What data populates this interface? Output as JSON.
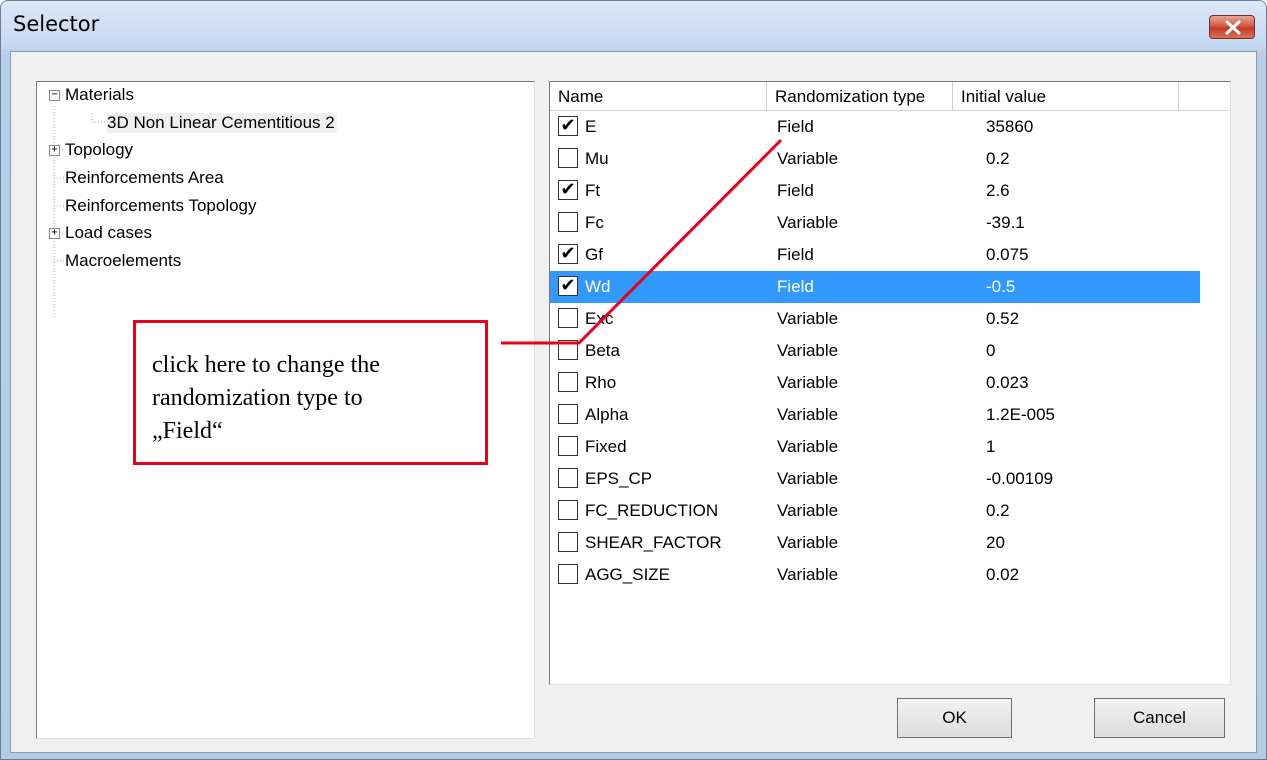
{
  "window": {
    "title": "Selector",
    "close_label": "close"
  },
  "tree": {
    "items": [
      {
        "label": "Materials",
        "expander": "minus"
      },
      {
        "label": "3D Non Linear Cementitious 2",
        "expander": ""
      },
      {
        "label": "Topology",
        "expander": "plus"
      },
      {
        "label": "Reinforcements Area",
        "expander": ""
      },
      {
        "label": "Reinforcements Topology",
        "expander": ""
      },
      {
        "label": "Load cases",
        "expander": "plus"
      },
      {
        "label": "Macroelements",
        "expander": ""
      }
    ]
  },
  "table": {
    "columns": [
      "Name",
      "Randomization type",
      "Initial value"
    ],
    "rows": [
      {
        "checked": true,
        "name": "E",
        "type": "Field",
        "value": "35860"
      },
      {
        "checked": false,
        "name": "Mu",
        "type": "Variable",
        "value": "0.2"
      },
      {
        "checked": true,
        "name": "Ft",
        "type": "Field",
        "value": "2.6"
      },
      {
        "checked": false,
        "name": "Fc",
        "type": "Variable",
        "value": "-39.1"
      },
      {
        "checked": true,
        "name": "Gf",
        "type": "Field",
        "value": "0.075"
      },
      {
        "checked": true,
        "name": "Wd",
        "type": "Field",
        "value": "-0.5",
        "selected": true
      },
      {
        "checked": false,
        "name": "Exc",
        "type": "Variable",
        "value": "0.52"
      },
      {
        "checked": false,
        "name": "Beta",
        "type": "Variable",
        "value": "0"
      },
      {
        "checked": false,
        "name": "Rho",
        "type": "Variable",
        "value": "0.023"
      },
      {
        "checked": false,
        "name": "Alpha",
        "type": "Variable",
        "value": "1.2E-005"
      },
      {
        "checked": false,
        "name": "Fixed",
        "type": "Variable",
        "value": "1"
      },
      {
        "checked": false,
        "name": "EPS_CP",
        "type": "Variable",
        "value": "-0.00109"
      },
      {
        "checked": false,
        "name": "FC_REDUCTION",
        "type": "Variable",
        "value": "0.2"
      },
      {
        "checked": false,
        "name": "SHEAR_FACTOR",
        "type": "Variable",
        "value": "20"
      },
      {
        "checked": false,
        "name": "AGG_SIZE",
        "type": "Variable",
        "value": "0.02"
      }
    ]
  },
  "buttons": {
    "ok": "OK",
    "cancel": "Cancel"
  },
  "callout": {
    "line1": "click here to change the",
    "line2": "randomization type to",
    "line3": "„Field“",
    "color": "#e8001c"
  },
  "colors": {
    "selection": "#3399ff",
    "close_button": "#c23a20"
  }
}
